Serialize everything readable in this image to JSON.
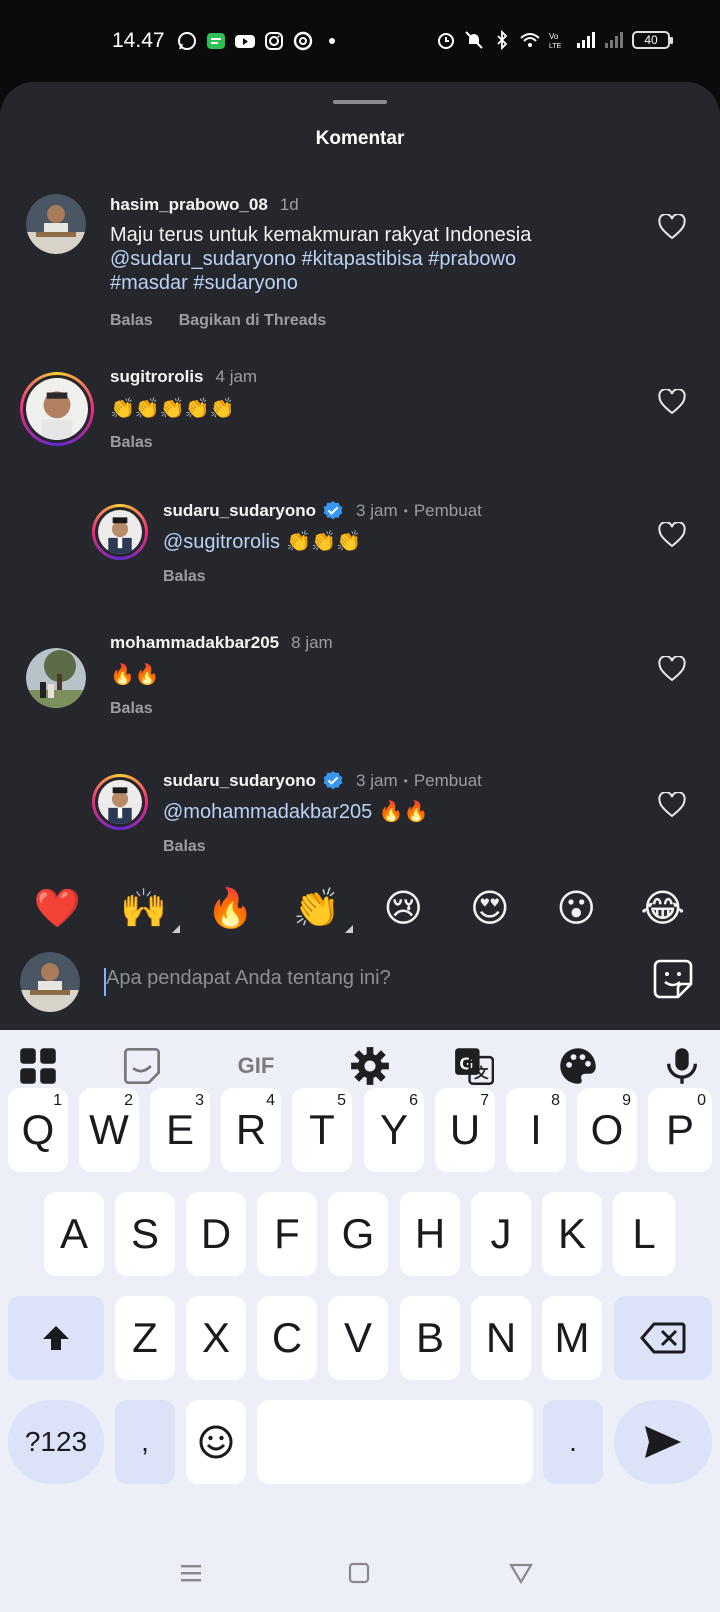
{
  "status_bar": {
    "time": "14.47",
    "battery": "40"
  },
  "sheet": {
    "title": "Komentar"
  },
  "comments": [
    {
      "username": "hasim_prabowo_08",
      "time": "1d",
      "text": "Maju terus  untuk kemakmuran rakyat Indonesia",
      "line2": "@sudaru_sudaryono #kitapastibisa #prabowo",
      "line3": "#masdar #sudaryono",
      "reply": "Balas",
      "share": "Bagikan di Threads"
    },
    {
      "username": "sugitrorolis",
      "time": "4 jam",
      "text": "👏👏👏👏👏",
      "reply": "Balas"
    },
    {
      "username": "sudaru_sudaryono",
      "time": "3 jam",
      "author": "Pembuat",
      "mention": "@sugitrorolis",
      "text": " 👏👏👏",
      "reply": "Balas"
    },
    {
      "username": "mohammadakbar205",
      "time": "8 jam",
      "text": "🔥🔥",
      "reply": "Balas"
    },
    {
      "username": "sudaru_sudaryono",
      "time": "3 jam",
      "author": "Pembuat",
      "mention": "@mohammadakbar205",
      "text": " 🔥🔥",
      "reply": "Balas"
    }
  ],
  "emoji_bar": [
    "❤️",
    "🙌",
    "🔥",
    "👏",
    "😢",
    "😍",
    "😮",
    "😂"
  ],
  "input": {
    "placeholder": "Apa pendapat Anda tentang ini?"
  },
  "keyboard": {
    "toolbar": {
      "gif": "GIF"
    },
    "row1": [
      "Q",
      "W",
      "E",
      "R",
      "T",
      "Y",
      "U",
      "I",
      "O",
      "P"
    ],
    "row1_hints": [
      "1",
      "2",
      "3",
      "4",
      "5",
      "6",
      "7",
      "8",
      "9",
      "0"
    ],
    "row2": [
      "A",
      "S",
      "D",
      "F",
      "G",
      "H",
      "J",
      "K",
      "L"
    ],
    "row3": [
      "Z",
      "X",
      "C",
      "V",
      "B",
      "N",
      "M"
    ],
    "symbols": "?123",
    "comma": ",",
    "period": "."
  }
}
